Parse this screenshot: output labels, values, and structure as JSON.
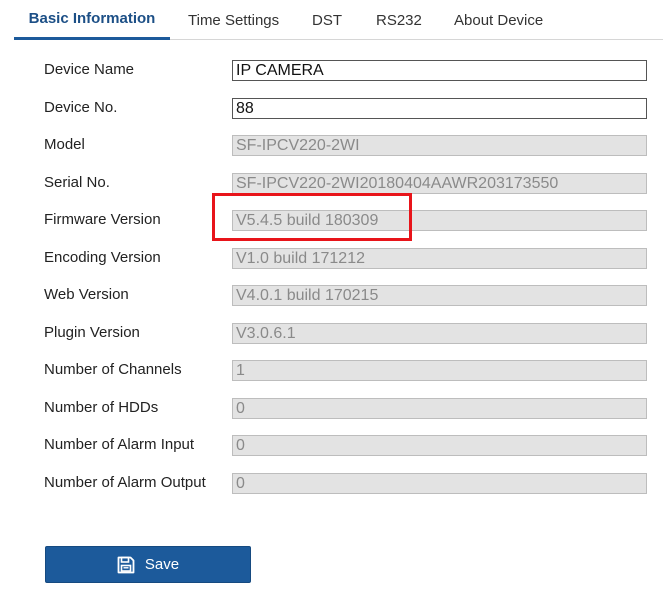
{
  "tabs": [
    {
      "label": "Basic Information",
      "active": true
    },
    {
      "label": "Time Settings",
      "active": false
    },
    {
      "label": "DST",
      "active": false
    },
    {
      "label": "RS232",
      "active": false
    },
    {
      "label": "About Device",
      "active": false
    }
  ],
  "form": {
    "device_name": {
      "label": "Device Name",
      "value": "IP CAMERA",
      "editable": true
    },
    "device_no": {
      "label": "Device No.",
      "value": "88",
      "editable": true
    },
    "model": {
      "label": "Model",
      "value": "SF-IPCV220-2WI",
      "editable": false
    },
    "serial_no": {
      "label": "Serial No.",
      "value": "SF-IPCV220-2WI20180404AAWR203173550",
      "editable": false
    },
    "firmware_version": {
      "label": "Firmware Version",
      "value": "V5.4.5 build 180309",
      "editable": false
    },
    "encoding_version": {
      "label": "Encoding Version",
      "value": "V1.0 build 171212",
      "editable": false
    },
    "web_version": {
      "label": "Web Version",
      "value": "V4.0.1 build 170215",
      "editable": false
    },
    "plugin_version": {
      "label": "Plugin Version",
      "value": "V3.0.6.1",
      "editable": false
    },
    "num_channels": {
      "label": "Number of Channels",
      "value": "1",
      "editable": false
    },
    "num_hdds": {
      "label": "Number of HDDs",
      "value": "0",
      "editable": false
    },
    "num_alarm_input": {
      "label": "Number of Alarm Input",
      "value": "0",
      "editable": false
    },
    "num_alarm_output": {
      "label": "Number of Alarm Output",
      "value": "0",
      "editable": false
    }
  },
  "save_button": {
    "label": "Save",
    "icon": "floppy-disk-icon"
  },
  "colors": {
    "accent": "#1c5a9b",
    "highlight": "#e8141a",
    "readonly_bg": "#e3e3e3"
  }
}
